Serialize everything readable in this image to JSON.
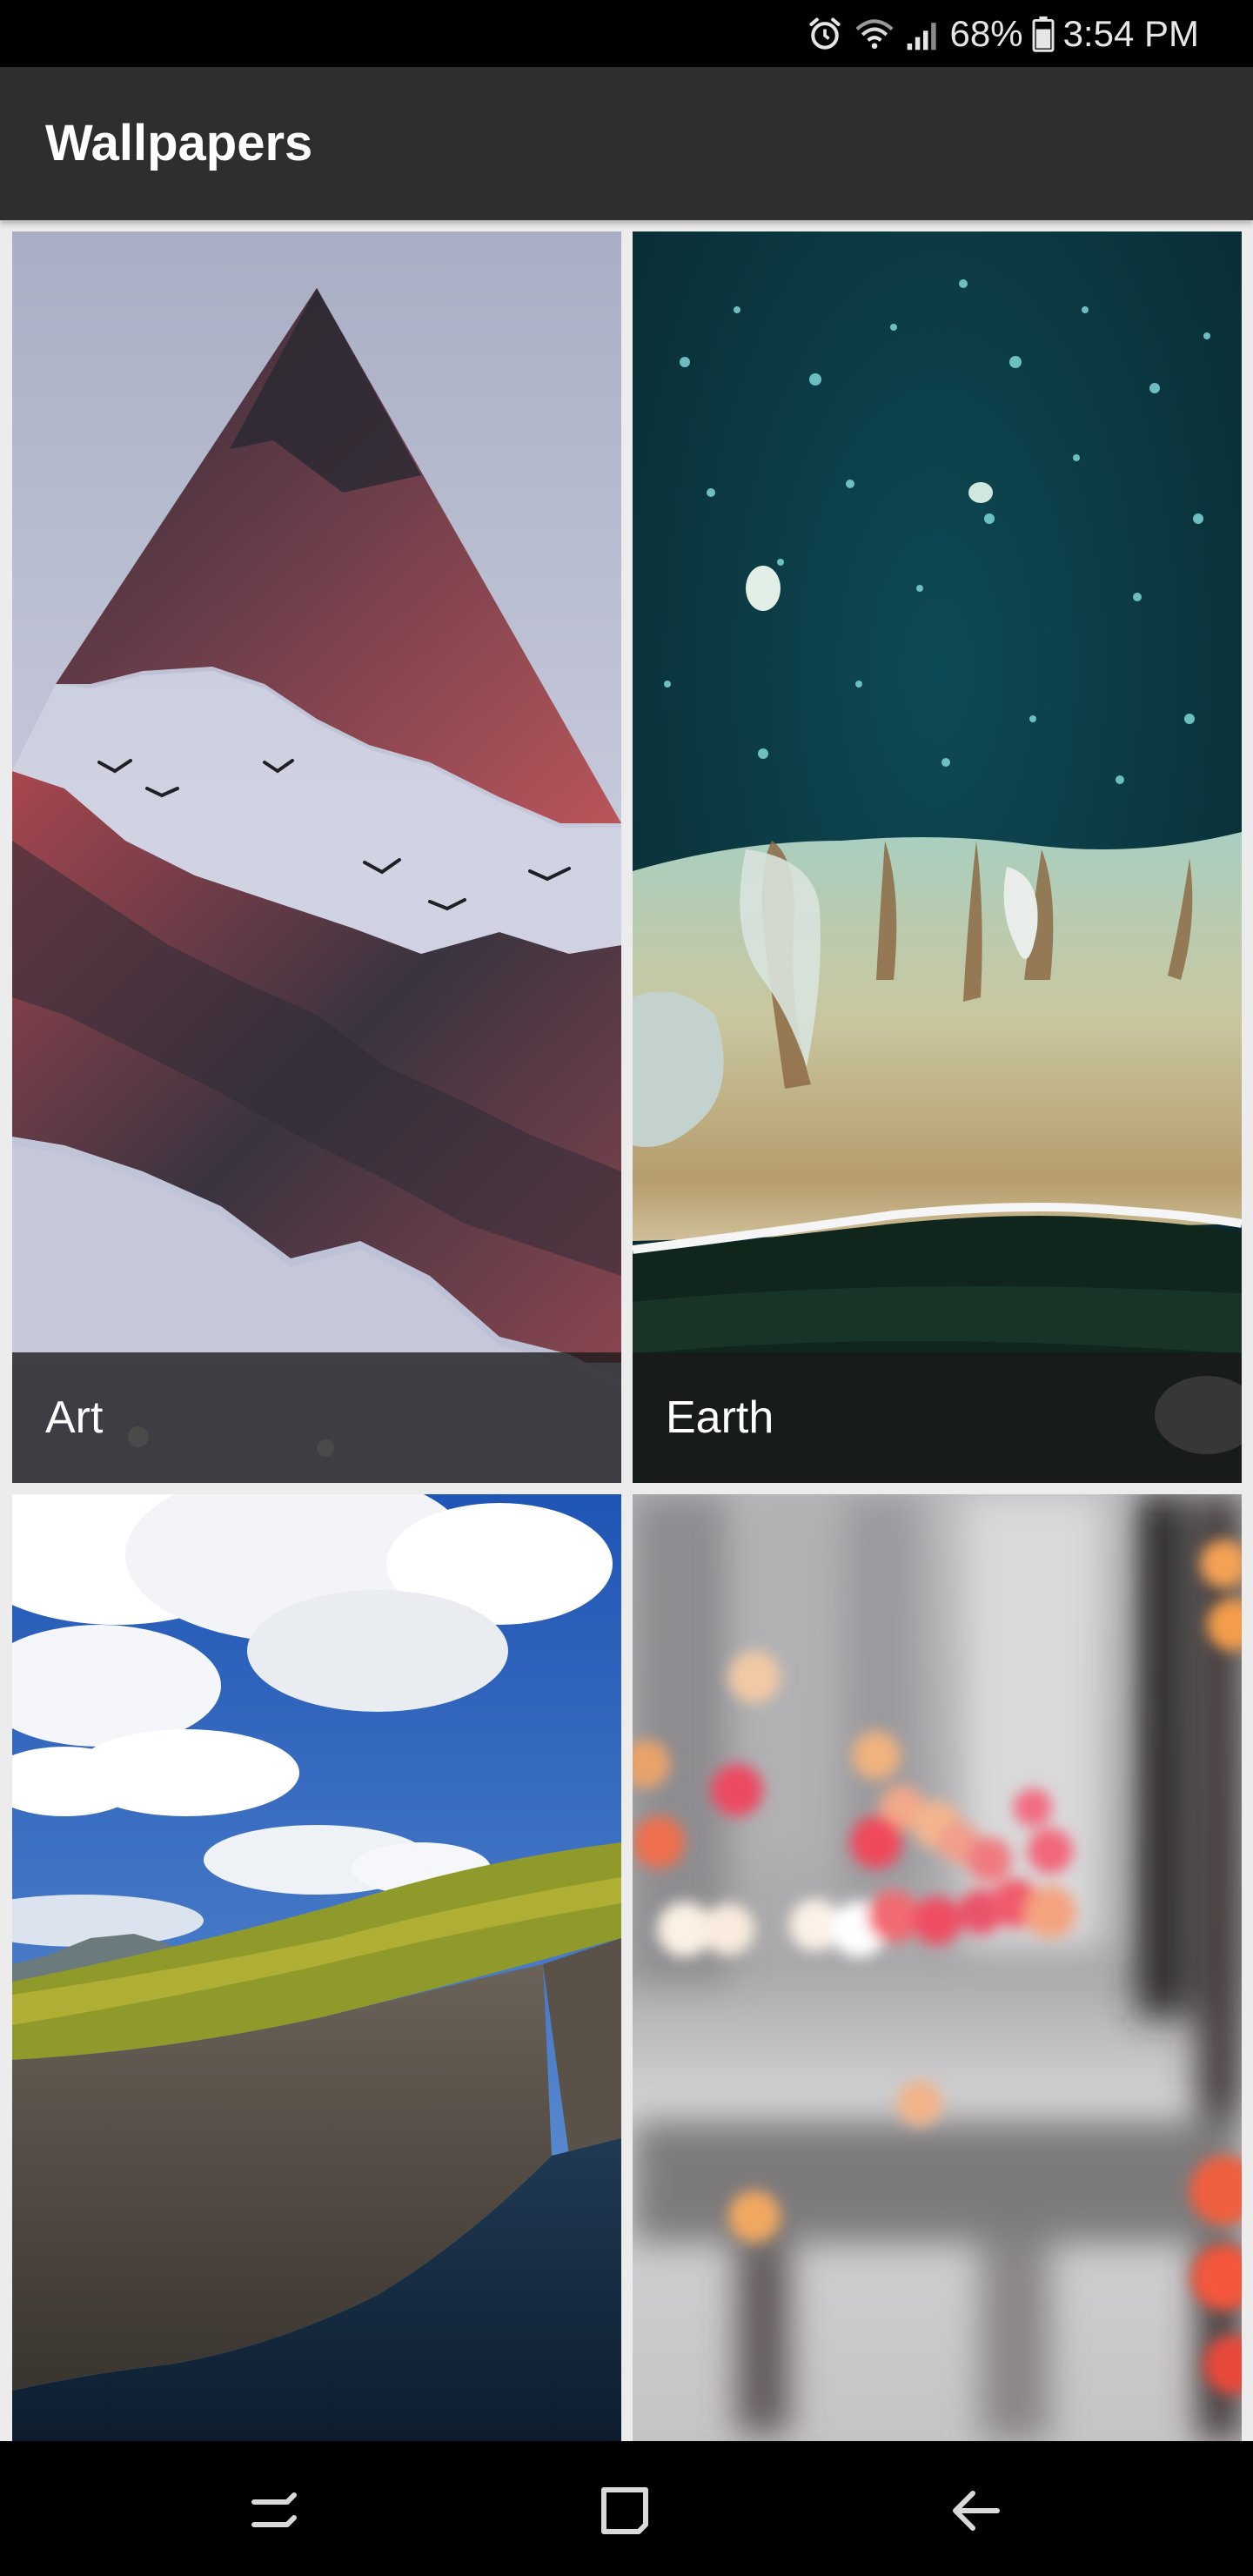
{
  "status_bar": {
    "icons": [
      "alarm-icon",
      "wifi-icon",
      "signal-icon",
      "battery-icon"
    ],
    "battery": "68%",
    "time": "3:54 PM"
  },
  "app_bar": {
    "title": "Wallpapers"
  },
  "categories": [
    {
      "label": "Art",
      "image": "triangle-mountain-birds-art"
    },
    {
      "label": "Earth",
      "image": "aerial-coastline-earth"
    },
    {
      "label": "",
      "image": "green-cliffs-ocean-landscape"
    },
    {
      "label": "",
      "image": "blurred-city-bokeh-lights"
    }
  ],
  "nav_bar": {
    "icons": [
      "recents-icon",
      "home-icon",
      "back-icon"
    ]
  },
  "colors": {
    "status_bar": "#000000",
    "app_bar": "#2e2e2e",
    "grid_background": "#ececec",
    "caption_overlay": "#191919"
  }
}
